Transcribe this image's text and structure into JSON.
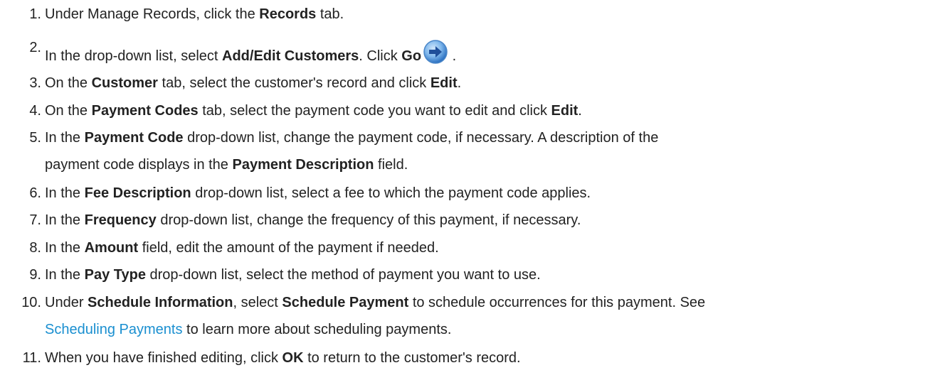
{
  "steps": [
    {
      "num": "1.",
      "parts": [
        "Under Manage Records, click the ",
        "Records",
        " tab."
      ]
    },
    {
      "num": "2.",
      "parts": [
        "In the drop-down list, select ",
        "Add/Edit Customers",
        ". Click ",
        "Go",
        " ."
      ]
    },
    {
      "num": "3.",
      "parts": [
        "On the ",
        "Customer",
        " tab, select the customer's record and click ",
        "Edit",
        "."
      ]
    },
    {
      "num": "4.",
      "parts": [
        "On the ",
        "Payment Codes",
        " tab, select the payment code you want to edit and click ",
        "Edit",
        "."
      ]
    },
    {
      "num": "5.",
      "parts": [
        "In the ",
        "Payment Code",
        " drop-down list, change the payment code, if necessary. A description of the",
        "payment code displays in the ",
        "Payment Description",
        " field."
      ]
    },
    {
      "num": "6.",
      "parts": [
        "In the ",
        "Fee Description",
        " drop-down list, select a fee to which the payment code applies."
      ]
    },
    {
      "num": "7.",
      "parts": [
        "In the ",
        "Frequency",
        " drop-down list, change the frequency of this payment, if necessary."
      ]
    },
    {
      "num": "8.",
      "parts": [
        "In the ",
        "Amount",
        " field, edit the amount of the payment if needed."
      ]
    },
    {
      "num": "9.",
      "parts": [
        "In the ",
        "Pay Type",
        " drop-down list, select the method of payment you want to use."
      ]
    },
    {
      "num": "10.",
      "parts": [
        "Under ",
        "Schedule Information",
        ", select ",
        "Schedule Payment",
        " to schedule occurrences for this payment. See",
        "Scheduling Payments",
        " to learn more about scheduling payments."
      ]
    },
    {
      "num": "11.",
      "parts": [
        "When you have finished editing, click ",
        "OK",
        " to return to the customer's record."
      ]
    }
  ],
  "icons": {
    "go": "go-arrow-icon"
  },
  "colors": {
    "link": "#1a8fd0",
    "text": "#222222",
    "icon": "#2a7fd4"
  }
}
